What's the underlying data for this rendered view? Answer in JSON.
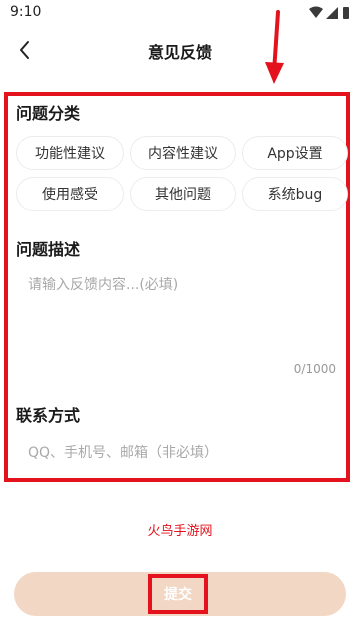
{
  "status_bar": {
    "time": "9:10",
    "icons": [
      "wifi-icon",
      "signal-icon",
      "battery-icon"
    ]
  },
  "header": {
    "title": "意见反馈",
    "back_icon": "chevron-left-icon"
  },
  "category": {
    "title": "问题分类",
    "chips": [
      "功能性建议",
      "内容性建议",
      "App设置",
      "使用感受",
      "其他问题",
      "系统bug"
    ]
  },
  "description": {
    "title": "问题描述",
    "placeholder": "请输入反馈内容...(必填)",
    "counter": "0/1000"
  },
  "contact": {
    "title": "联系方式",
    "placeholder": "QQ、手机号、邮箱（非必填）"
  },
  "watermark": "火鸟手游网",
  "submit": {
    "label": "提交"
  },
  "colors": {
    "annotation_red": "#e4121c",
    "submit_bg": "#f1d7c4",
    "chip_border": "#ececec",
    "placeholder": "#a8a8a8"
  }
}
